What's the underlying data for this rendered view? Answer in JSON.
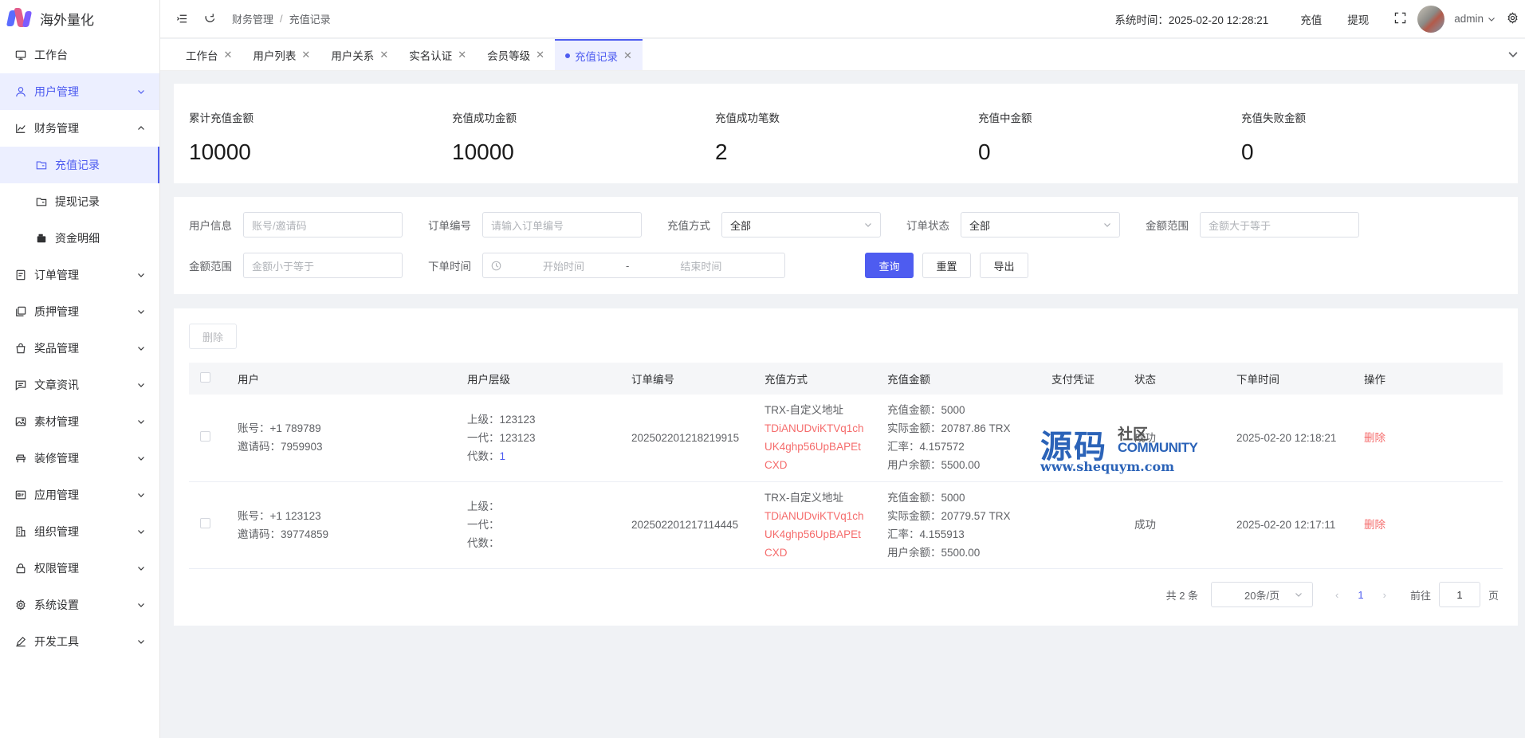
{
  "app": {
    "name": "海外量化"
  },
  "sidebar": {
    "items": [
      {
        "label": "工作台",
        "icon": "monitor-icon"
      },
      {
        "label": "用户管理",
        "icon": "user-icon"
      },
      {
        "label": "财务管理",
        "icon": "chart-icon"
      },
      {
        "label": "充值记录",
        "icon": "folder-icon"
      },
      {
        "label": "提现记录",
        "icon": "folder-icon"
      },
      {
        "label": "资金明细",
        "icon": "wallet-icon"
      },
      {
        "label": "订单管理",
        "icon": "document-icon"
      },
      {
        "label": "质押管理",
        "icon": "copy-icon"
      },
      {
        "label": "奖品管理",
        "icon": "bag-icon"
      },
      {
        "label": "文章资讯",
        "icon": "message-icon"
      },
      {
        "label": "素材管理",
        "icon": "image-icon"
      },
      {
        "label": "装修管理",
        "icon": "brush-icon"
      },
      {
        "label": "应用管理",
        "icon": "app-icon"
      },
      {
        "label": "组织管理",
        "icon": "building-icon"
      },
      {
        "label": "权限管理",
        "icon": "lock-icon"
      },
      {
        "label": "系统设置",
        "icon": "gear-icon"
      },
      {
        "label": "开发工具",
        "icon": "pen-icon"
      }
    ]
  },
  "header": {
    "breadcrumb": [
      "财务管理",
      "充值记录"
    ],
    "system_time": "系统时间：2025-02-20 12:28:21",
    "recharge": "充值",
    "withdraw": "提现",
    "username": "admin"
  },
  "tabs": [
    {
      "label": "工作台"
    },
    {
      "label": "用户列表"
    },
    {
      "label": "用户关系"
    },
    {
      "label": "实名认证"
    },
    {
      "label": "会员等级"
    },
    {
      "label": "充值记录"
    }
  ],
  "stats": [
    {
      "label": "累计充值金额",
      "value": "10000"
    },
    {
      "label": "充值成功金额",
      "value": "10000"
    },
    {
      "label": "充值成功笔数",
      "value": "2"
    },
    {
      "label": "充值中金额",
      "value": "0"
    },
    {
      "label": "充值失败金额",
      "value": "0"
    }
  ],
  "filters": {
    "user_info": {
      "label": "用户信息",
      "placeholder": "账号/邀请码"
    },
    "order_no": {
      "label": "订单编号",
      "placeholder": "请输入订单编号"
    },
    "method": {
      "label": "充值方式",
      "value": "全部"
    },
    "status": {
      "label": "订单状态",
      "value": "全部"
    },
    "amount_min": {
      "label": "金额范围",
      "placeholder": "金额大于等于"
    },
    "amount_max": {
      "label": "金额范围",
      "placeholder": "金额小于等于"
    },
    "order_time": {
      "label": "下单时间",
      "start": "开始时间",
      "sep": "-",
      "end": "结束时间"
    },
    "query": "查询",
    "reset": "重置",
    "export": "导出"
  },
  "table": {
    "delete_btn": "删除",
    "columns": [
      "用户",
      "用户层级",
      "订单编号",
      "充值方式",
      "充值金额",
      "支付凭证",
      "状态",
      "下单时间",
      "操作"
    ],
    "rows": [
      {
        "account": "账号：+1 789789",
        "invite": "邀请码：7959903",
        "parent": "上级：123123",
        "first_gen": "一代：123123",
        "gen_label": "代数：",
        "gen_value": "1",
        "order_no": "202502201218219915",
        "method": "TRX-自定义地址",
        "address_lines": [
          "TDiANUDviKTVq1ch",
          "UK4ghp56UpBAPEt",
          "CXD"
        ],
        "recharge_amount": "充值金额：5000",
        "actual_amount": "实际金额：20787.86 TRX",
        "rate": "汇率：4.157572",
        "balance": "用户余额：5500.00",
        "status": "成功",
        "time": "2025-02-20 12:18:21",
        "action": "删除"
      },
      {
        "account": "账号：+1 123123",
        "invite": "邀请码：39774859",
        "parent": "上级：",
        "first_gen": "一代：",
        "gen_label": "代数：",
        "gen_value": "",
        "order_no": "202502201217114445",
        "method": "TRX-自定义地址",
        "address_lines": [
          "TDiANUDviKTVq1ch",
          "UK4ghp56UpBAPEt",
          "CXD"
        ],
        "recharge_amount": "充值金额：5000",
        "actual_amount": "实际金额：20779.57 TRX",
        "rate": "汇率：4.155913",
        "balance": "用户余额：5500.00",
        "status": "成功",
        "time": "2025-02-20 12:17:11",
        "action": "删除"
      }
    ]
  },
  "pagination": {
    "total": "共 2 条",
    "page_size": "20条/页",
    "current": "1",
    "goto_label": "前往",
    "goto_value": "1",
    "page_suffix": "页"
  },
  "watermark": {
    "big": "源码",
    "small": "社区",
    "community": "COMMUNITY",
    "url": "www.shequym.com"
  },
  "colors": {
    "accent": "#4e5cf0",
    "danger": "#f56c6c"
  }
}
